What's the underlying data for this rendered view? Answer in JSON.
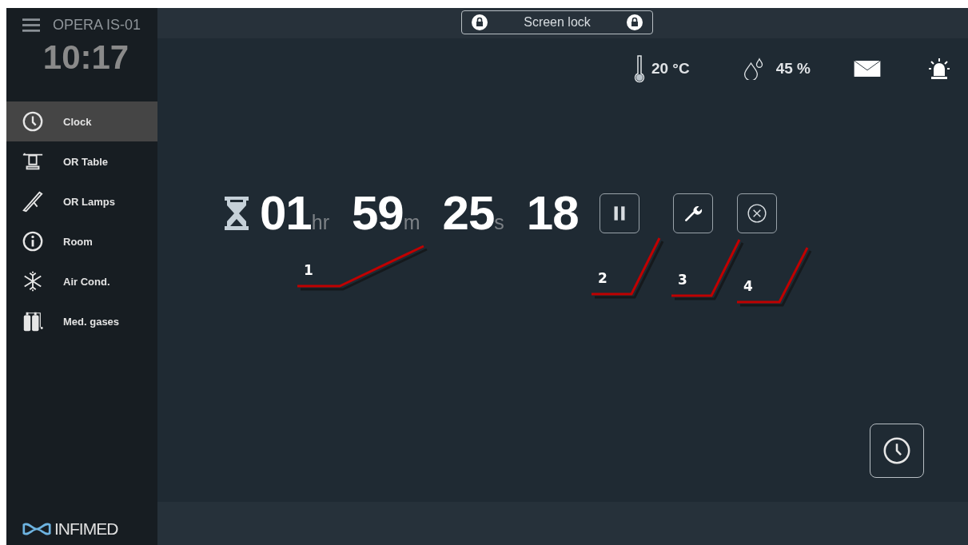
{
  "header": {
    "title": "OPERA IS-01",
    "time": "10:17"
  },
  "nav": [
    {
      "label": "Clock",
      "selected": true
    },
    {
      "label": "OR Table",
      "selected": false
    },
    {
      "label": "OR Lamps",
      "selected": false
    },
    {
      "label": "Room",
      "selected": false
    },
    {
      "label": "Air Cond.",
      "selected": false
    },
    {
      "label": "Med. gases",
      "selected": false
    }
  ],
  "logo": "INFIMED",
  "screen_lock": {
    "label": "Screen lock"
  },
  "status": {
    "temperature": "20 °C",
    "humidity": "45 %"
  },
  "timer": {
    "segments": [
      {
        "value": "01",
        "unit": "hr"
      },
      {
        "value": "59",
        "unit": "m"
      },
      {
        "value": "25",
        "unit": "s"
      },
      {
        "value": "18"
      }
    ]
  },
  "controls": [
    {
      "kind": "pause"
    },
    {
      "kind": "settings"
    },
    {
      "kind": "cancel"
    }
  ],
  "callouts": [
    "1",
    "2",
    "3",
    "4"
  ]
}
